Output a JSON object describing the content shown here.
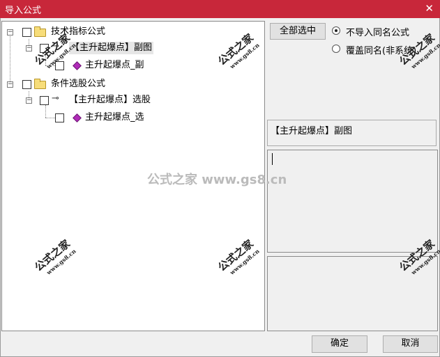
{
  "window": {
    "title": "导入公式",
    "close_glyph": "✕"
  },
  "tree": {
    "groups": [
      {
        "label": "技术指标公式",
        "items": [
          {
            "label": "【主升起爆点】副图",
            "children": [
              {
                "label": "主升起爆点_副"
              }
            ]
          }
        ]
      },
      {
        "label": "条件选股公式",
        "items": [
          {
            "label": "【主升起爆点】选股",
            "children": [
              {
                "label": "主升起爆点_选"
              }
            ]
          }
        ]
      }
    ],
    "expander_glyph": "−"
  },
  "controls": {
    "select_all": "全部选中",
    "radio_skip": "不导入同名公式",
    "radio_overwrite": "覆盖同名(非系统)",
    "selected_radio": "skip"
  },
  "detail": {
    "name": "【主升起爆点】副图"
  },
  "buttons": {
    "ok": "确定",
    "cancel": "取消"
  },
  "watermark": {
    "mark": "公式之家",
    "url": "www.gs8.cn",
    "center": "公式之家 www.gs8.cn"
  },
  "colors": {
    "titlebar": "#c8273a",
    "gem": "#b02bb8",
    "folder": "#f7dd7a"
  }
}
